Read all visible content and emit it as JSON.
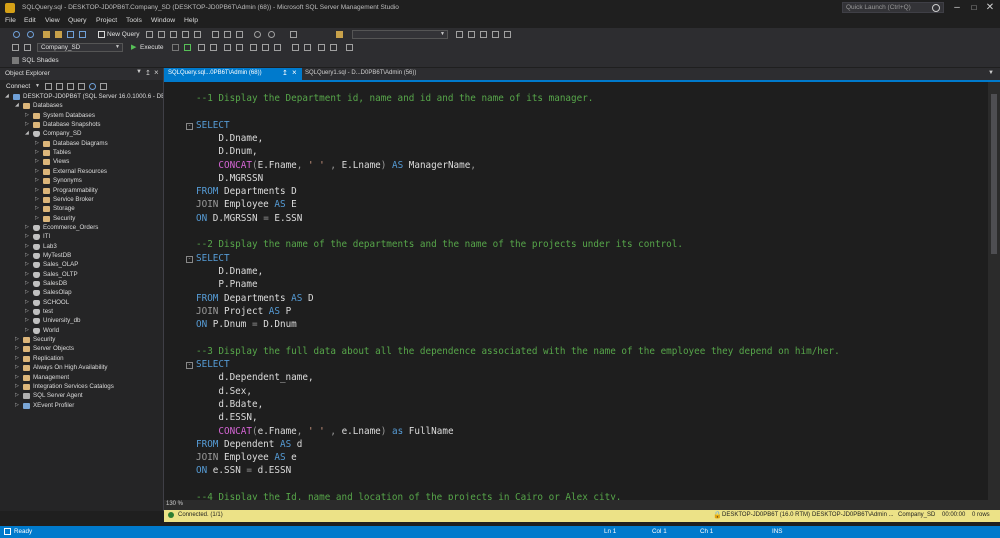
{
  "window": {
    "title": "SQLQuery.sql - DESKTOP-JD0PB6T.Company_SD (DESKTOP-JD0PB6T\\Admin (68)) - Microsoft SQL Server Management Studio",
    "quick_launch_placeholder": "Quick Launch (Ctrl+Q)"
  },
  "menu": [
    "File",
    "Edit",
    "View",
    "Query",
    "Project",
    "Tools",
    "Window",
    "Help"
  ],
  "toolbar": {
    "new_query_label": "New Query",
    "database_selected": "Company_SD",
    "execute_label": "Execute",
    "sql_shades_label": "SQL Shades"
  },
  "object_explorer": {
    "title": "Object Explorer",
    "connect_label": "Connect",
    "tree": [
      {
        "label": "DESKTOP-JD0PB6T (SQL Server 16.0.1000.6 - DESK",
        "level": 0,
        "icon": "server",
        "expanded": true
      },
      {
        "label": "Databases",
        "level": 1,
        "icon": "folder",
        "expanded": true
      },
      {
        "label": "System Databases",
        "level": 2,
        "icon": "folder",
        "expanded": false
      },
      {
        "label": "Database Snapshots",
        "level": 2,
        "icon": "folder",
        "expanded": false
      },
      {
        "label": "Company_SD",
        "level": 2,
        "icon": "db",
        "expanded": true
      },
      {
        "label": "Database Diagrams",
        "level": 3,
        "icon": "folder",
        "expanded": false
      },
      {
        "label": "Tables",
        "level": 3,
        "icon": "folder",
        "expanded": false
      },
      {
        "label": "Views",
        "level": 3,
        "icon": "folder",
        "expanded": false
      },
      {
        "label": "External Resources",
        "level": 3,
        "icon": "folder",
        "expanded": false
      },
      {
        "label": "Synonyms",
        "level": 3,
        "icon": "folder",
        "expanded": false
      },
      {
        "label": "Programmability",
        "level": 3,
        "icon": "folder",
        "expanded": false
      },
      {
        "label": "Service Broker",
        "level": 3,
        "icon": "folder",
        "expanded": false
      },
      {
        "label": "Storage",
        "level": 3,
        "icon": "folder",
        "expanded": false
      },
      {
        "label": "Security",
        "level": 3,
        "icon": "folder",
        "expanded": false
      },
      {
        "label": "Ecommerce_Orders",
        "level": 2,
        "icon": "db",
        "expanded": false
      },
      {
        "label": "ITI",
        "level": 2,
        "icon": "db",
        "expanded": false
      },
      {
        "label": "Lab3",
        "level": 2,
        "icon": "db",
        "expanded": false
      },
      {
        "label": "MyTestDB",
        "level": 2,
        "icon": "db",
        "expanded": false
      },
      {
        "label": "Sales_OLAP",
        "level": 2,
        "icon": "db",
        "expanded": false
      },
      {
        "label": "Sales_OLTP",
        "level": 2,
        "icon": "db",
        "expanded": false
      },
      {
        "label": "SalesDB",
        "level": 2,
        "icon": "db",
        "expanded": false
      },
      {
        "label": "SalesOlap",
        "level": 2,
        "icon": "db",
        "expanded": false
      },
      {
        "label": "SCHOOL",
        "level": 2,
        "icon": "db",
        "expanded": false
      },
      {
        "label": "test",
        "level": 2,
        "icon": "db",
        "expanded": false
      },
      {
        "label": "University_db",
        "level": 2,
        "icon": "db",
        "expanded": false
      },
      {
        "label": "World",
        "level": 2,
        "icon": "db",
        "expanded": false
      },
      {
        "label": "Security",
        "level": 1,
        "icon": "folder",
        "expanded": false
      },
      {
        "label": "Server Objects",
        "level": 1,
        "icon": "folder",
        "expanded": false
      },
      {
        "label": "Replication",
        "level": 1,
        "icon": "folder",
        "expanded": false
      },
      {
        "label": "Always On High Availability",
        "level": 1,
        "icon": "folder",
        "expanded": false
      },
      {
        "label": "Management",
        "level": 1,
        "icon": "folder",
        "expanded": false
      },
      {
        "label": "Integration Services Catalogs",
        "level": 1,
        "icon": "folder",
        "expanded": false
      },
      {
        "label": "SQL Server Agent",
        "level": 1,
        "icon": "agent",
        "expanded": false
      },
      {
        "label": "XEvent Profiler",
        "level": 1,
        "icon": "xe",
        "expanded": false
      }
    ]
  },
  "tabs": [
    {
      "label": "SQLQuery.sql...0PB6T\\Admin (68))",
      "active": true
    },
    {
      "label": "SQLQuery1.sql - D...D0PB6T\\Admin (56))",
      "active": false
    }
  ],
  "editor": {
    "zoom": "130 %",
    "lines": [
      {
        "tokens": [
          [
            "cm",
            "--1 Display the Department id, name and id and the name of its manager."
          ]
        ]
      },
      {
        "tokens": []
      },
      {
        "fold": true,
        "tokens": [
          [
            "kw",
            "SELECT"
          ]
        ]
      },
      {
        "tokens": [
          [
            "",
            "    D.Dname,"
          ]
        ]
      },
      {
        "tokens": [
          [
            "",
            "    D.Dnum,"
          ]
        ]
      },
      {
        "tokens": [
          [
            "",
            "    "
          ],
          [
            "fn",
            "CONCAT"
          ],
          [
            "gr",
            "("
          ],
          [
            "",
            "E.Fname"
          ],
          [
            "gr",
            ", "
          ],
          [
            "str",
            "' '"
          ],
          [
            "gr",
            " , "
          ],
          [
            "",
            "E.Lname"
          ],
          [
            "gr",
            ") "
          ],
          [
            "kw",
            "AS"
          ],
          [
            "",
            " ManagerName"
          ],
          [
            "gr",
            ","
          ]
        ]
      },
      {
        "tokens": [
          [
            "",
            "    D.MGRSSN"
          ]
        ]
      },
      {
        "tokens": [
          [
            "kw",
            "FROM"
          ],
          [
            "",
            " Departments D"
          ]
        ]
      },
      {
        "tokens": [
          [
            "gr",
            "JOIN"
          ],
          [
            "",
            " Employee "
          ],
          [
            "kw",
            "AS"
          ],
          [
            "",
            " E"
          ]
        ]
      },
      {
        "tokens": [
          [
            "kw",
            "ON"
          ],
          [
            "",
            " D.MGRSSN "
          ],
          [
            "gr",
            "="
          ],
          [
            "",
            " E.SSN"
          ]
        ]
      },
      {
        "tokens": []
      },
      {
        "tokens": [
          [
            "cm",
            "--2 Display the name of the departments and the name of the projects under its control."
          ]
        ]
      },
      {
        "fold": true,
        "tokens": [
          [
            "kw",
            "SELECT"
          ]
        ]
      },
      {
        "tokens": [
          [
            "",
            "    D.Dname,"
          ]
        ]
      },
      {
        "tokens": [
          [
            "",
            "    P.Pname"
          ]
        ]
      },
      {
        "tokens": [
          [
            "kw",
            "FROM"
          ],
          [
            "",
            " Departments "
          ],
          [
            "kw",
            "AS"
          ],
          [
            "",
            " D"
          ]
        ]
      },
      {
        "tokens": [
          [
            "gr",
            "JOIN"
          ],
          [
            "",
            " Project "
          ],
          [
            "kw",
            "AS"
          ],
          [
            "",
            " P"
          ]
        ]
      },
      {
        "tokens": [
          [
            "kw",
            "ON"
          ],
          [
            "",
            " P.Dnum "
          ],
          [
            "gr",
            "="
          ],
          [
            "",
            " D.Dnum"
          ]
        ]
      },
      {
        "tokens": []
      },
      {
        "tokens": [
          [
            "cm",
            "--3 Display the full data about all the dependence associated with the name of the employee they depend on him/her."
          ]
        ]
      },
      {
        "fold": true,
        "tokens": [
          [
            "kw",
            "SELECT"
          ]
        ]
      },
      {
        "tokens": [
          [
            "",
            "    d.Dependent_name,"
          ]
        ]
      },
      {
        "tokens": [
          [
            "",
            "    d.Sex,"
          ]
        ]
      },
      {
        "tokens": [
          [
            "",
            "    d.Bdate,"
          ]
        ]
      },
      {
        "tokens": [
          [
            "",
            "    d.ESSN,"
          ]
        ]
      },
      {
        "tokens": [
          [
            "",
            "    "
          ],
          [
            "fn",
            "CONCAT"
          ],
          [
            "gr",
            "("
          ],
          [
            "",
            "e.Fname"
          ],
          [
            "gr",
            ", "
          ],
          [
            "str",
            "' '"
          ],
          [
            "gr",
            " , "
          ],
          [
            "",
            "e.Lname"
          ],
          [
            "gr",
            ") "
          ],
          [
            "kw",
            "as"
          ],
          [
            "",
            " FullName"
          ]
        ]
      },
      {
        "tokens": [
          [
            "kw",
            "FROM"
          ],
          [
            "",
            " Dependent "
          ],
          [
            "kw",
            "AS"
          ],
          [
            "",
            " d"
          ]
        ]
      },
      {
        "tokens": [
          [
            "gr",
            "JOIN"
          ],
          [
            "",
            " Employee "
          ],
          [
            "kw",
            "AS"
          ],
          [
            "",
            " e"
          ]
        ]
      },
      {
        "tokens": [
          [
            "kw",
            "ON"
          ],
          [
            "",
            " e.SSN "
          ],
          [
            "gr",
            "="
          ],
          [
            "",
            " d.ESSN"
          ]
        ]
      },
      {
        "tokens": []
      },
      {
        "tokens": [
          [
            "cm",
            "--4 Display the Id, name and location of the projects in Cairo or Alex city."
          ]
        ]
      }
    ]
  },
  "query_status": {
    "connected": "Connected. (1/1)",
    "server": "DESKTOP-JD0PB6T (16.0 RTM)",
    "user": "DESKTOP-JD0PB6T\\Admin ...",
    "database": "Company_SD",
    "elapsed": "00:00:00",
    "rows": "0 rows"
  },
  "status_bar": {
    "ready": "Ready",
    "line": "Ln 1",
    "col": "Col 1",
    "ch": "Ch 1",
    "mode": "INS"
  },
  "colors": {
    "accent": "#007acc",
    "query_status_bg": "#ece287",
    "keyword": "#569cd6",
    "function": "#d565d5",
    "comment": "#57a64a",
    "string": "#d69d85"
  }
}
